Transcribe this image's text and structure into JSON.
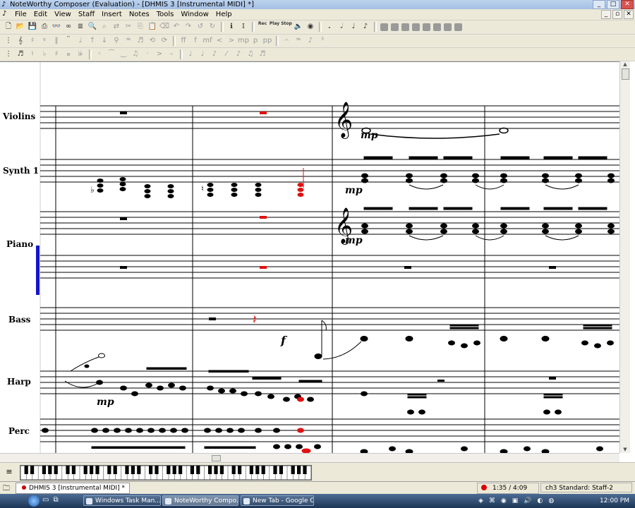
{
  "window": {
    "title": "NoteWorthy Composer (Evaluation) - [DHMIS 3 [Instrumental MIDI] *]",
    "controls": [
      "_",
      "□",
      "✕"
    ]
  },
  "menu": {
    "items": [
      "File",
      "Edit",
      "View",
      "Staff",
      "Insert",
      "Notes",
      "Tools",
      "Window",
      "Help"
    ],
    "mdi_controls": [
      "_",
      "▫",
      "✕"
    ]
  },
  "toolbar1": {
    "rec_label": "Rec",
    "play_label": "Play",
    "stop_label": "Stop",
    "tools": [
      "new-icon",
      "open-icon",
      "save-icon",
      "print-icon",
      "viewer-icon",
      "audition-icon",
      "staff-props-icon",
      "zoom-icon",
      "find-icon",
      "replace-icon",
      "cut-icon",
      "copy-icon",
      "paste-icon",
      "clear-icon",
      "undo-icon",
      "redo-icon",
      "info-icon",
      "lyrics-icon"
    ]
  },
  "staves": [
    {
      "name": "Violins"
    },
    {
      "name": "Synth 1"
    },
    {
      "name": "Piano"
    },
    {
      "name": "Bass"
    },
    {
      "name": "Harp"
    },
    {
      "name": "Perc"
    }
  ],
  "dynamics": {
    "violins": "mp",
    "synth": "mp",
    "piano": "mp",
    "bass": "f",
    "harp": "mp"
  },
  "accent_color": "#e01010",
  "selection_bar_color": "#1515c8",
  "status": {
    "document_tab": "DHMIS 3 [Instrumental MIDI] *",
    "position": "1:35 / 4:09",
    "staff_info": "ch3 Standard: Staff-2"
  },
  "taskbar": {
    "tasks": [
      {
        "label": "Windows Task Man...",
        "active": false
      },
      {
        "label": "NoteWorthy Compo...",
        "active": true
      },
      {
        "label": "New Tab - Google C...",
        "active": false
      }
    ],
    "clock": "12:00 PM"
  }
}
